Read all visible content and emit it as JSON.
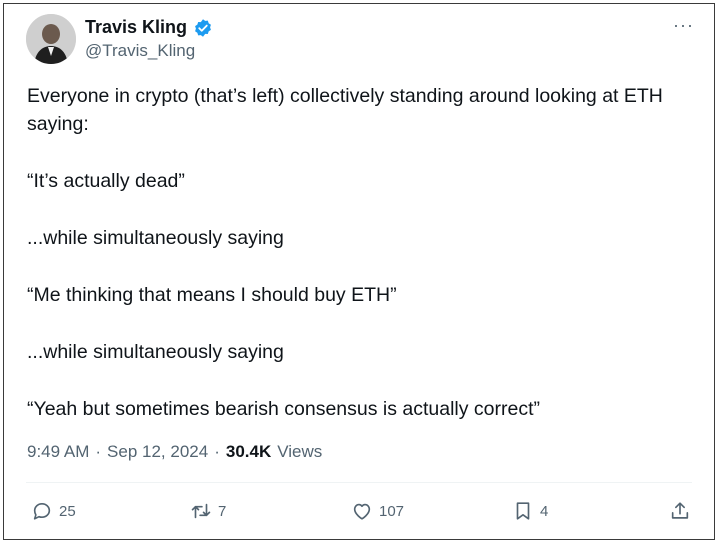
{
  "author": {
    "name": "Travis Kling",
    "handle": "@Travis_Kling",
    "verified_color": "#1d9bf0"
  },
  "more_label": "···",
  "tweet": {
    "lines": [
      "Everyone in crypto (that’s left) collectively standing around looking at ETH saying:",
      "“It’s actually dead”",
      "...while simultaneously saying",
      "“Me thinking that means I should buy ETH”",
      "...while simultaneously saying",
      "“Yeah but sometimes bearish consensus is actually correct”"
    ]
  },
  "meta": {
    "time": "9:49 AM",
    "separator": "·",
    "date": "Sep 12, 2024",
    "views_count": "30.4K",
    "views_label": "Views"
  },
  "actions": {
    "replies": "25",
    "reposts": "7",
    "likes": "107",
    "bookmarks": "4"
  }
}
